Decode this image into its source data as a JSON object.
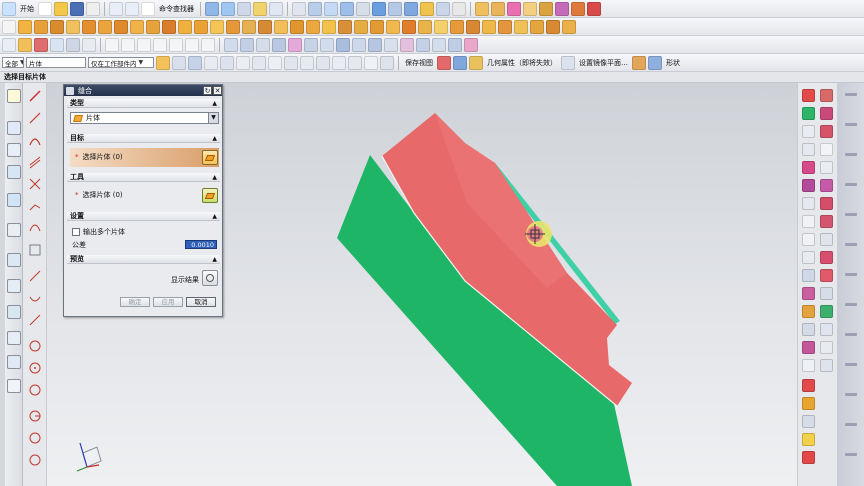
{
  "menu": {
    "start_label": "开始",
    "command_finder_label": "命令查找器"
  },
  "selection_bar": {
    "filter_value": "全部",
    "type_filter_value": "片体",
    "scope_value": "仅在工作部件内",
    "save_view_label": "保存视图",
    "geometric_property_label": "几何属性（即将失效）",
    "mirror_plane_label": "设置镜像平面…",
    "shape_label": "形状"
  },
  "status": {
    "prompt": "选择目标片体"
  },
  "dialog": {
    "title": "缝合",
    "type_section": "类型",
    "type_value": "片体",
    "target_section": "目标",
    "target_select_label": "选择片体 (0)",
    "tool_section": "工具",
    "tool_select_label": "选择片体 (0)",
    "settings_section": "设置",
    "output_multiple_label": "输出多个片体",
    "tolerance_label": "公差",
    "tolerance_value": "0.0010",
    "preview_section": "预览",
    "show_result_label": "显示结果",
    "ok_label": "确定",
    "apply_label": "应用",
    "cancel_label": "取消"
  },
  "colors": {
    "model_red": "#e8696a",
    "model_green": "#1fb566",
    "model_teal": "#3fd0a6",
    "highlight_yellow": "#e9e36a",
    "dialog_title_bg": "#2c3853"
  }
}
